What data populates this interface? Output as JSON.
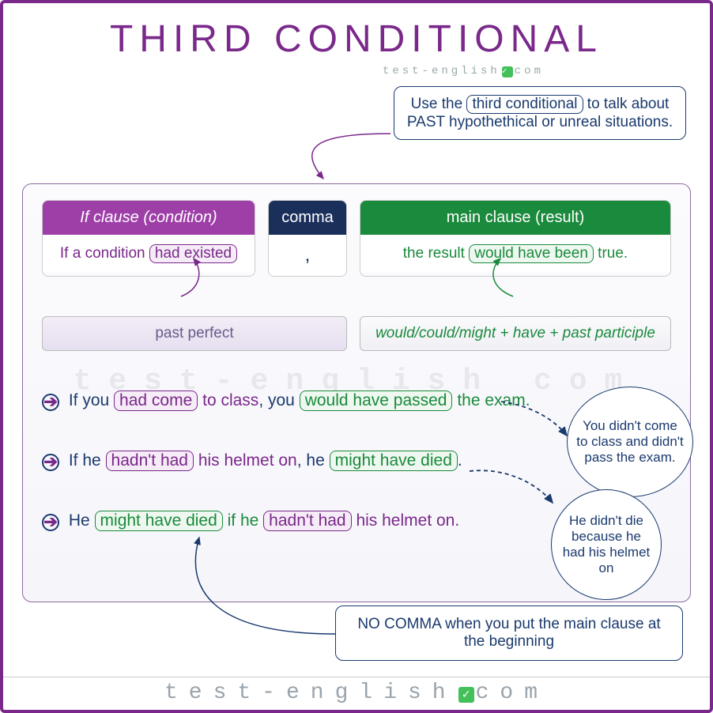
{
  "title": "THIRD CONDITIONAL",
  "brand_small": {
    "pre": "test-english",
    "post": "com"
  },
  "callout_top": {
    "pre": "Use the ",
    "pill": "third conditional",
    "post": " to talk about PAST hypothethical or unreal situations."
  },
  "cards": {
    "if_head": "If clause (condition)",
    "if_body_pre": "If a condition ",
    "if_body_pill": "had existed",
    "comma_head": "comma",
    "comma_body": ",",
    "main_head": "main clause (result)",
    "main_body_pre": "the result ",
    "main_body_pill": "would have been",
    "main_body_post": " true."
  },
  "sub": {
    "left": "past perfect",
    "right": "would/could/might + have + past participle"
  },
  "watermark": "test-english  com",
  "examples": [
    {
      "p1": "If you ",
      "pp": "had come",
      "p2": " to class",
      "p3": ", you ",
      "gp": "would have passed",
      "p4": " the exam."
    },
    {
      "p1": "If he ",
      "pp": "hadn't had",
      "p2": " his helmet on",
      "p3": ", he ",
      "gp": "might have died",
      "p4": "."
    },
    {
      "p1": "He ",
      "gp": "might have died",
      "p2": " if he ",
      "pp": "hadn't had",
      "p4": " his helmet on."
    }
  ],
  "bubbles": {
    "b1": "You didn't come to class and didn't pass the exam.",
    "b2": "He didn't die because he had his helmet on"
  },
  "callout_bottom": "NO COMMA when you put the main clause at the beginning",
  "footer": {
    "pre": "test-english",
    "post": "com"
  }
}
